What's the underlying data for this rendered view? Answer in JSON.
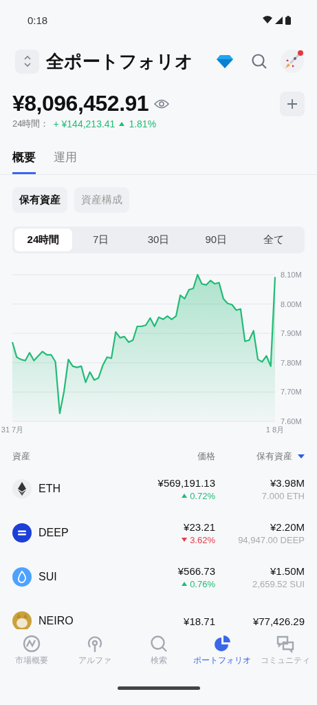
{
  "status_bar": {
    "time": "0:18"
  },
  "header": {
    "title": "全ポートフォリオ"
  },
  "balance": {
    "amount": "¥8,096,452.91",
    "period_label": "24時間：",
    "change": "+ ¥144,213.41",
    "change_pct": "1.81%",
    "rising": true
  },
  "tabs": [
    {
      "label": "概要",
      "selected": true
    },
    {
      "label": "運用",
      "selected": false
    }
  ],
  "views": [
    {
      "label": "保有資産",
      "selected": true
    },
    {
      "label": "資産構成",
      "selected": false
    }
  ],
  "ranges": [
    {
      "label": "24時間",
      "selected": true
    },
    {
      "label": "7日",
      "selected": false
    },
    {
      "label": "30日",
      "selected": false
    },
    {
      "label": "90日",
      "selected": false
    },
    {
      "label": "全て",
      "selected": false
    }
  ],
  "chart_data": {
    "type": "area",
    "ylim": [
      7.6,
      8.1
    ],
    "grid": true,
    "categories": [
      "31 7月",
      null,
      null,
      null,
      null,
      null,
      null,
      null,
      null,
      null,
      null,
      null,
      null,
      null,
      null,
      null,
      null,
      null,
      null,
      null,
      null,
      null,
      null,
      null,
      null,
      null,
      null,
      null,
      null,
      null,
      null,
      null,
      null,
      null,
      null,
      null,
      null,
      null,
      null,
      null,
      null,
      null,
      null,
      null,
      null,
      null,
      null,
      null,
      null,
      null,
      null,
      null,
      null,
      null,
      null,
      null,
      null,
      null,
      null,
      null,
      null,
      "1 8月"
    ],
    "yticks": [
      {
        "value": 8.1,
        "label": "8.10M"
      },
      {
        "value": 8.0,
        "label": "8.00M"
      },
      {
        "value": 7.9,
        "label": "7.90M"
      },
      {
        "value": 7.8,
        "label": "7.80M"
      },
      {
        "value": 7.7,
        "label": "7.70M"
      },
      {
        "value": 7.6,
        "label": "7.60M"
      }
    ],
    "series": [
      {
        "color": "#22bb77",
        "values": [
          7.87,
          7.819,
          7.811,
          7.807,
          7.834,
          7.807,
          7.823,
          7.838,
          7.827,
          7.827,
          7.803,
          7.627,
          7.702,
          7.811,
          7.788,
          7.784,
          7.788,
          7.733,
          7.768,
          7.741,
          7.748,
          7.791,
          7.819,
          7.815,
          7.905,
          7.885,
          7.889,
          7.87,
          7.877,
          7.924,
          7.924,
          7.928,
          7.952,
          7.924,
          7.955,
          7.948,
          7.959,
          7.948,
          7.959,
          8.03,
          8.018,
          8.049,
          8.053,
          8.1,
          8.069,
          8.065,
          8.08,
          8.069,
          8.073,
          8.018,
          8.002,
          7.998,
          7.979,
          7.983,
          7.873,
          7.877,
          7.909,
          7.811,
          7.803,
          7.823,
          7.788,
          8.092
        ]
      }
    ]
  },
  "table": {
    "columns": [
      "資産",
      "価格",
      "保有資産"
    ],
    "rows": [
      {
        "symbol": "ETH",
        "price": "¥569,191.13",
        "change": "0.72%",
        "rising": true,
        "value": "¥3.98M",
        "amount": "7.000 ETH"
      },
      {
        "symbol": "DEEP",
        "price": "¥23.21",
        "change": "3.62%",
        "rising": false,
        "value": "¥2.20M",
        "amount": "94,947.00 DEEP"
      },
      {
        "symbol": "SUI",
        "price": "¥566.73",
        "change": "0.76%",
        "rising": true,
        "value": "¥1.50M",
        "amount": "2,659.52 SUI"
      },
      {
        "symbol": "NEIRO",
        "price": "¥18.71",
        "value": "¥77,426.29"
      }
    ]
  },
  "nav": [
    {
      "label": "市場概要",
      "selected": false
    },
    {
      "label": "アルファ",
      "selected": false
    },
    {
      "label": "検索",
      "selected": false
    },
    {
      "label": "ポートフォリオ",
      "selected": true
    },
    {
      "label": "コミュニティ",
      "selected": false
    }
  ]
}
